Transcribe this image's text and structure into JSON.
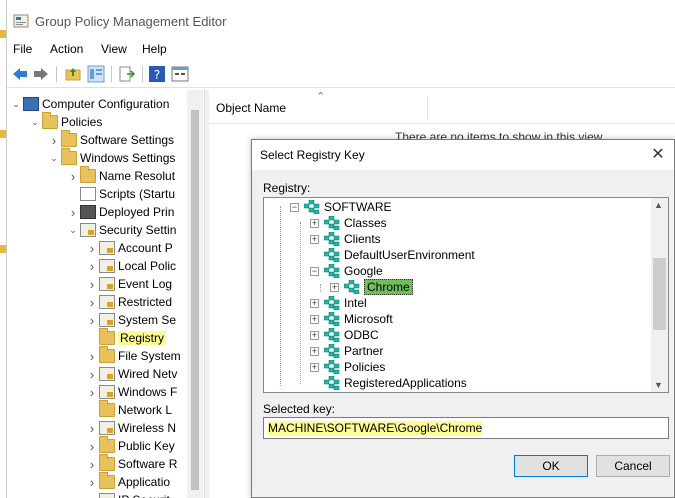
{
  "window": {
    "title": "Group Policy Management Editor"
  },
  "menu": [
    "File",
    "Action",
    "View",
    "Help"
  ],
  "toolbar_icons": [
    "back-arrow-icon",
    "forward-arrow-icon",
    "up-folder-icon",
    "show-hide-tree-icon",
    "export-list-icon",
    "help-icon",
    "properties-icon"
  ],
  "tree": {
    "items": [
      {
        "label": "Computer Configuration",
        "level": 0,
        "expanded": true,
        "icon": "computer-icon"
      },
      {
        "label": "Policies",
        "level": 1,
        "expanded": true,
        "icon": "folder-icon"
      },
      {
        "label": "Software Settings",
        "level": 2,
        "expanded": false,
        "icon": "folder-icon"
      },
      {
        "label": "Windows Settings",
        "level": 2,
        "expanded": true,
        "icon": "folder-icon"
      },
      {
        "label": "Name Resolut",
        "level": 3,
        "expanded": false,
        "icon": "folder-icon"
      },
      {
        "label": "Scripts (Startu",
        "level": 3,
        "expanded": null,
        "icon": "doc-icon"
      },
      {
        "label": "Deployed Prin",
        "level": 3,
        "expanded": false,
        "icon": "printer-icon"
      },
      {
        "label": "Security Settin",
        "level": 3,
        "expanded": true,
        "icon": "policy-icon"
      },
      {
        "label": "Account P",
        "level": 4,
        "expanded": false,
        "icon": "policy-icon"
      },
      {
        "label": "Local Polic",
        "level": 4,
        "expanded": false,
        "icon": "policy-icon"
      },
      {
        "label": "Event Log",
        "level": 4,
        "expanded": false,
        "icon": "policy-icon"
      },
      {
        "label": "Restricted",
        "level": 4,
        "expanded": false,
        "icon": "policy-icon"
      },
      {
        "label": "System Se",
        "level": 4,
        "expanded": false,
        "icon": "policy-icon"
      },
      {
        "label": "Registry",
        "level": 4,
        "expanded": null,
        "icon": "folder-icon",
        "selected": true
      },
      {
        "label": "File System",
        "level": 4,
        "expanded": false,
        "icon": "folder-icon"
      },
      {
        "label": "Wired Netv",
        "level": 4,
        "expanded": false,
        "icon": "policy-icon"
      },
      {
        "label": "Windows F",
        "level": 4,
        "expanded": false,
        "icon": "policy-icon"
      },
      {
        "label": "Network L",
        "level": 4,
        "expanded": null,
        "icon": "folder-icon"
      },
      {
        "label": "Wireless N",
        "level": 4,
        "expanded": false,
        "icon": "policy-icon"
      },
      {
        "label": "Public Key",
        "level": 4,
        "expanded": false,
        "icon": "folder-icon"
      },
      {
        "label": "Software R",
        "level": 4,
        "expanded": false,
        "icon": "folder-icon"
      },
      {
        "label": "Applicatio",
        "level": 4,
        "expanded": false,
        "icon": "folder-icon"
      },
      {
        "label": "IP Securit",
        "level": 4,
        "expanded": false,
        "icon": "policy-icon"
      }
    ]
  },
  "right_pane": {
    "column_header": "Object Name",
    "empty_message": "There are no items to show in this view."
  },
  "dialog": {
    "title": "Select Registry Key",
    "registry_label": "Registry:",
    "items": [
      {
        "label": "SOFTWARE",
        "level": 0,
        "expanded": true
      },
      {
        "label": "Classes",
        "level": 1,
        "expanded": false
      },
      {
        "label": "Clients",
        "level": 1,
        "expanded": false
      },
      {
        "label": "DefaultUserEnvironment",
        "level": 1,
        "expanded": null
      },
      {
        "label": "Google",
        "level": 1,
        "expanded": true
      },
      {
        "label": "Chrome",
        "level": 2,
        "expanded": false,
        "selected": true
      },
      {
        "label": "Intel",
        "level": 1,
        "expanded": false
      },
      {
        "label": "Microsoft",
        "level": 1,
        "expanded": false
      },
      {
        "label": "ODBC",
        "level": 1,
        "expanded": false
      },
      {
        "label": "Partner",
        "level": 1,
        "expanded": false
      },
      {
        "label": "Policies",
        "level": 1,
        "expanded": false
      },
      {
        "label": "RegisteredApplications",
        "level": 1,
        "expanded": null
      }
    ],
    "selected_key_label": "Selected key:",
    "selected_key_value": "MACHINE\\SOFTWARE\\Google\\Chrome",
    "ok_label": "OK",
    "cancel_label": "Cancel"
  },
  "colors": {
    "highlight_yellow": "#fdfb94",
    "selection_green": "#6fbf58",
    "folder_gold": "#e8c25a",
    "accent_blue": "#0078d7"
  }
}
